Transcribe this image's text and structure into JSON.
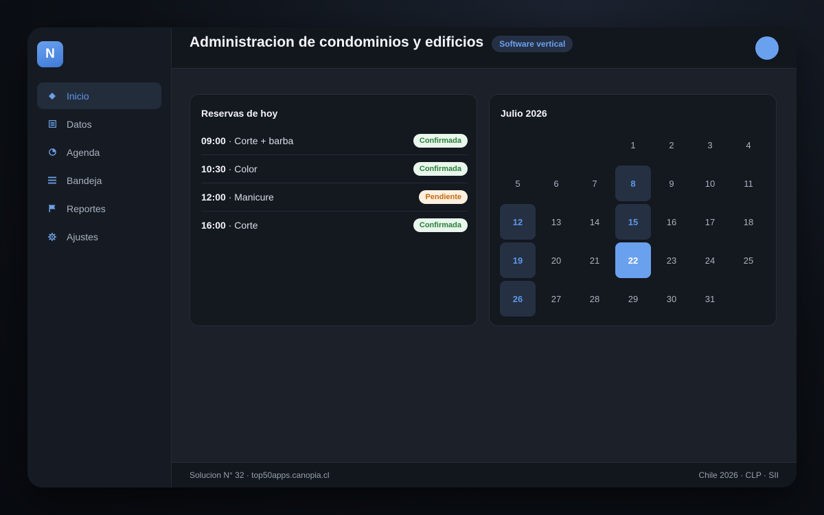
{
  "app": {
    "logo_letter": "N",
    "accent_color": "#6aa1ef"
  },
  "sidebar": {
    "items": [
      {
        "label": "Inicio",
        "icon": "diamond-icon",
        "active": true
      },
      {
        "label": "Datos",
        "icon": "list-icon",
        "active": false
      },
      {
        "label": "Agenda",
        "icon": "clock-icon",
        "active": false
      },
      {
        "label": "Bandeja",
        "icon": "menu-icon",
        "active": false
      },
      {
        "label": "Reportes",
        "icon": "flag-icon",
        "active": false
      },
      {
        "label": "Ajustes",
        "icon": "gear-icon",
        "active": false
      }
    ]
  },
  "header": {
    "title": "Administracion de condominios y edificios",
    "badge": "Software vertical"
  },
  "bookings": {
    "title": "Reservas de hoy",
    "items": [
      {
        "time": "09:00",
        "service": "Corte + barba",
        "status": "Confirmada",
        "status_type": "ok"
      },
      {
        "time": "10:30",
        "service": "Color",
        "status": "Confirmada",
        "status_type": "ok"
      },
      {
        "time": "12:00",
        "service": "Manicure",
        "status": "Pendiente",
        "status_type": "pending"
      },
      {
        "time": "16:00",
        "service": "Corte",
        "status": "Confirmada",
        "status_type": "ok"
      }
    ]
  },
  "calendar": {
    "title": "Julio 2026",
    "leading_blanks": 3,
    "days": [
      "1",
      "2",
      "3",
      "4",
      "5",
      "6",
      "7",
      "8",
      "9",
      "10",
      "11",
      "12",
      "13",
      "14",
      "15",
      "16",
      "17",
      "18",
      "19",
      "20",
      "21",
      "22",
      "23",
      "24",
      "25",
      "26",
      "27",
      "28",
      "29",
      "30",
      "31"
    ],
    "marked": [
      "8",
      "12",
      "15",
      "19",
      "26"
    ],
    "today": "22"
  },
  "footer": {
    "left": "Solucion N° 32 · top50apps.canopia.cl",
    "right": "Chile 2026 · CLP · SII"
  }
}
